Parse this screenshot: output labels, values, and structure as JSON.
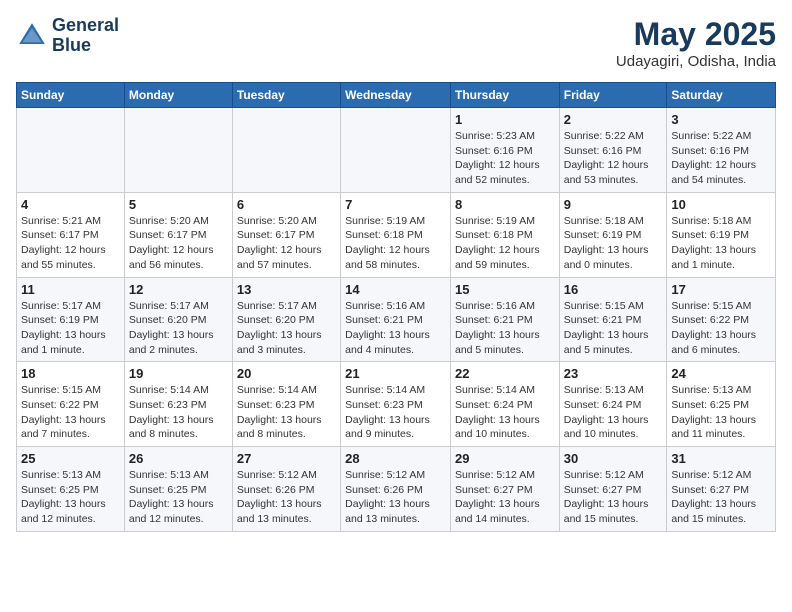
{
  "logo": {
    "line1": "General",
    "line2": "Blue"
  },
  "title": "May 2025",
  "subtitle": "Udayagiri, Odisha, India",
  "days_of_week": [
    "Sunday",
    "Monday",
    "Tuesday",
    "Wednesday",
    "Thursday",
    "Friday",
    "Saturday"
  ],
  "weeks": [
    [
      {
        "day": "",
        "info": ""
      },
      {
        "day": "",
        "info": ""
      },
      {
        "day": "",
        "info": ""
      },
      {
        "day": "",
        "info": ""
      },
      {
        "day": "1",
        "info": "Sunrise: 5:23 AM\nSunset: 6:16 PM\nDaylight: 12 hours\nand 52 minutes."
      },
      {
        "day": "2",
        "info": "Sunrise: 5:22 AM\nSunset: 6:16 PM\nDaylight: 12 hours\nand 53 minutes."
      },
      {
        "day": "3",
        "info": "Sunrise: 5:22 AM\nSunset: 6:16 PM\nDaylight: 12 hours\nand 54 minutes."
      }
    ],
    [
      {
        "day": "4",
        "info": "Sunrise: 5:21 AM\nSunset: 6:17 PM\nDaylight: 12 hours\nand 55 minutes."
      },
      {
        "day": "5",
        "info": "Sunrise: 5:20 AM\nSunset: 6:17 PM\nDaylight: 12 hours\nand 56 minutes."
      },
      {
        "day": "6",
        "info": "Sunrise: 5:20 AM\nSunset: 6:17 PM\nDaylight: 12 hours\nand 57 minutes."
      },
      {
        "day": "7",
        "info": "Sunrise: 5:19 AM\nSunset: 6:18 PM\nDaylight: 12 hours\nand 58 minutes."
      },
      {
        "day": "8",
        "info": "Sunrise: 5:19 AM\nSunset: 6:18 PM\nDaylight: 12 hours\nand 59 minutes."
      },
      {
        "day": "9",
        "info": "Sunrise: 5:18 AM\nSunset: 6:19 PM\nDaylight: 13 hours\nand 0 minutes."
      },
      {
        "day": "10",
        "info": "Sunrise: 5:18 AM\nSunset: 6:19 PM\nDaylight: 13 hours\nand 1 minute."
      }
    ],
    [
      {
        "day": "11",
        "info": "Sunrise: 5:17 AM\nSunset: 6:19 PM\nDaylight: 13 hours\nand 1 minute."
      },
      {
        "day": "12",
        "info": "Sunrise: 5:17 AM\nSunset: 6:20 PM\nDaylight: 13 hours\nand 2 minutes."
      },
      {
        "day": "13",
        "info": "Sunrise: 5:17 AM\nSunset: 6:20 PM\nDaylight: 13 hours\nand 3 minutes."
      },
      {
        "day": "14",
        "info": "Sunrise: 5:16 AM\nSunset: 6:21 PM\nDaylight: 13 hours\nand 4 minutes."
      },
      {
        "day": "15",
        "info": "Sunrise: 5:16 AM\nSunset: 6:21 PM\nDaylight: 13 hours\nand 5 minutes."
      },
      {
        "day": "16",
        "info": "Sunrise: 5:15 AM\nSunset: 6:21 PM\nDaylight: 13 hours\nand 5 minutes."
      },
      {
        "day": "17",
        "info": "Sunrise: 5:15 AM\nSunset: 6:22 PM\nDaylight: 13 hours\nand 6 minutes."
      }
    ],
    [
      {
        "day": "18",
        "info": "Sunrise: 5:15 AM\nSunset: 6:22 PM\nDaylight: 13 hours\nand 7 minutes."
      },
      {
        "day": "19",
        "info": "Sunrise: 5:14 AM\nSunset: 6:23 PM\nDaylight: 13 hours\nand 8 minutes."
      },
      {
        "day": "20",
        "info": "Sunrise: 5:14 AM\nSunset: 6:23 PM\nDaylight: 13 hours\nand 8 minutes."
      },
      {
        "day": "21",
        "info": "Sunrise: 5:14 AM\nSunset: 6:23 PM\nDaylight: 13 hours\nand 9 minutes."
      },
      {
        "day": "22",
        "info": "Sunrise: 5:14 AM\nSunset: 6:24 PM\nDaylight: 13 hours\nand 10 minutes."
      },
      {
        "day": "23",
        "info": "Sunrise: 5:13 AM\nSunset: 6:24 PM\nDaylight: 13 hours\nand 10 minutes."
      },
      {
        "day": "24",
        "info": "Sunrise: 5:13 AM\nSunset: 6:25 PM\nDaylight: 13 hours\nand 11 minutes."
      }
    ],
    [
      {
        "day": "25",
        "info": "Sunrise: 5:13 AM\nSunset: 6:25 PM\nDaylight: 13 hours\nand 12 minutes."
      },
      {
        "day": "26",
        "info": "Sunrise: 5:13 AM\nSunset: 6:25 PM\nDaylight: 13 hours\nand 12 minutes."
      },
      {
        "day": "27",
        "info": "Sunrise: 5:12 AM\nSunset: 6:26 PM\nDaylight: 13 hours\nand 13 minutes."
      },
      {
        "day": "28",
        "info": "Sunrise: 5:12 AM\nSunset: 6:26 PM\nDaylight: 13 hours\nand 13 minutes."
      },
      {
        "day": "29",
        "info": "Sunrise: 5:12 AM\nSunset: 6:27 PM\nDaylight: 13 hours\nand 14 minutes."
      },
      {
        "day": "30",
        "info": "Sunrise: 5:12 AM\nSunset: 6:27 PM\nDaylight: 13 hours\nand 15 minutes."
      },
      {
        "day": "31",
        "info": "Sunrise: 5:12 AM\nSunset: 6:27 PM\nDaylight: 13 hours\nand 15 minutes."
      }
    ]
  ]
}
